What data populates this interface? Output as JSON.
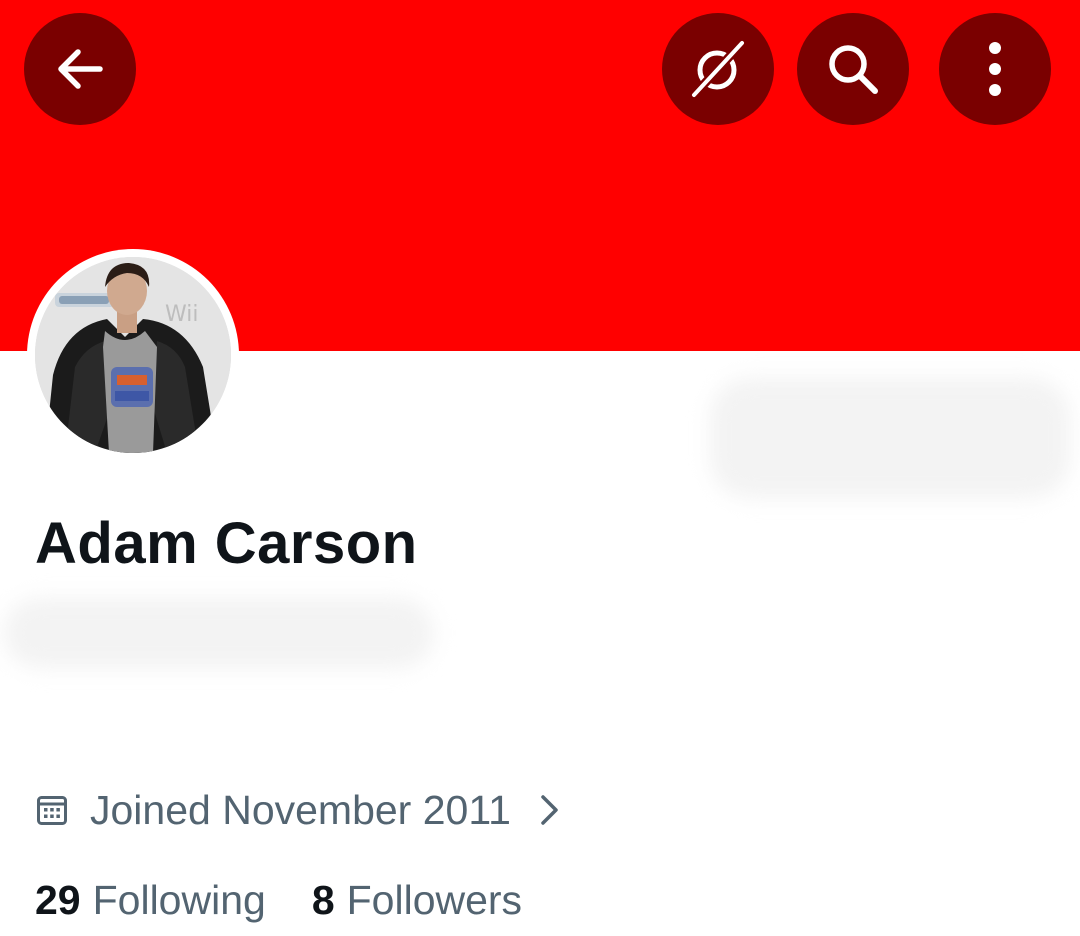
{
  "profile": {
    "name": "Adam Carson",
    "joined": "Joined November 2011",
    "following_count": "29",
    "following_label": "Following",
    "followers_count": "8",
    "followers_label": "Followers"
  },
  "header": {
    "icons": [
      "back-arrow-icon",
      "grok-icon",
      "search-icon",
      "more-vertical-icon"
    ]
  },
  "colors": {
    "banner": "#ff0000",
    "header_button": "#7a0000",
    "text_primary": "#0f1419",
    "text_secondary": "#536471"
  }
}
